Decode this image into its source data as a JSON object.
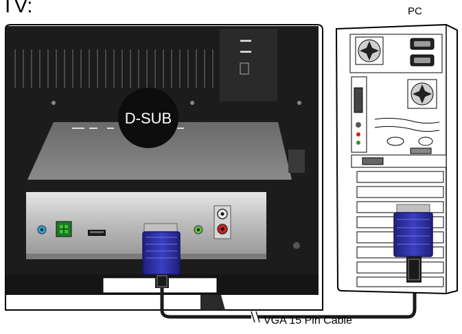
{
  "labels": {
    "tv": "TV:",
    "pc": "PC",
    "connector": "D-SUB",
    "cable": "VGA 15 Pin Cable"
  },
  "colors": {
    "tv_body": "#1c1c1c",
    "tv_vent": "#3a3a3a",
    "panel_silver": "#c8c8c8",
    "vga_plug_blue": "#2d2f9e",
    "pc_outline": "#000000",
    "cable": "#1a1a1a"
  }
}
